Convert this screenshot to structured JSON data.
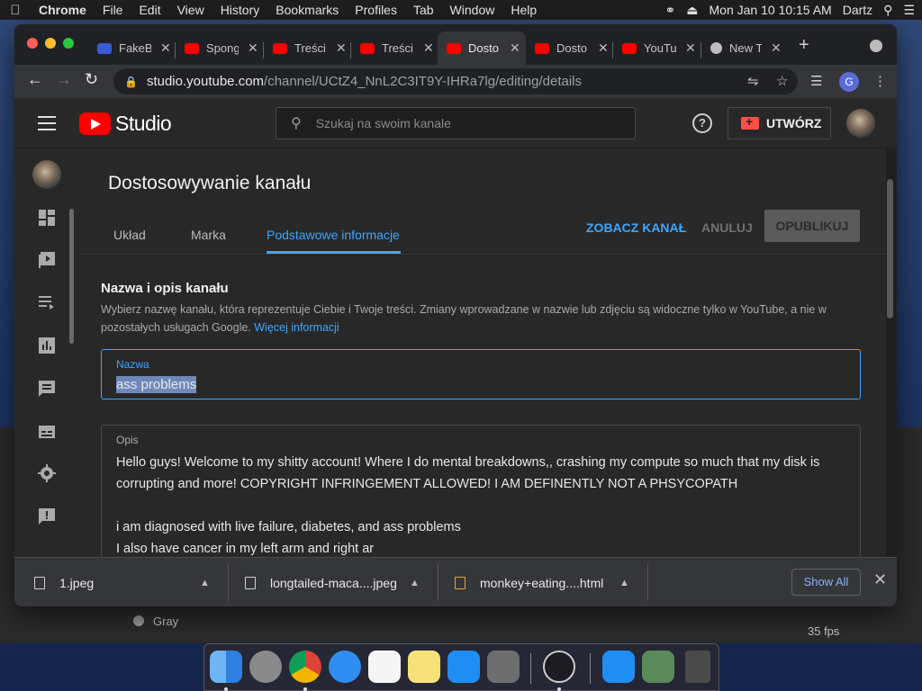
{
  "menubar": {
    "apple": "",
    "items": [
      "Chrome",
      "File",
      "Edit",
      "View",
      "History",
      "Bookmarks",
      "Profiles",
      "Tab",
      "Window",
      "Help"
    ],
    "datetime": "Mon Jan 10  10:15 AM",
    "user": "Dartz"
  },
  "tabs": [
    {
      "title": "FakeB",
      "color": "#3a5bd9"
    },
    {
      "title": "Spong",
      "color": "#ff0000"
    },
    {
      "title": "Treści",
      "color": "#ff0000"
    },
    {
      "title": "Treści",
      "color": "#ff0000"
    },
    {
      "title": "Dosto",
      "color": "#ff0000"
    },
    {
      "title": "Dosto",
      "color": "#ff0000"
    },
    {
      "title": "YouTu",
      "color": "#ff0000"
    },
    {
      "title": "New T",
      "color": "#bdbdbd"
    }
  ],
  "address": {
    "host": "studio.youtube.com",
    "path": "/channel/UCtZ4_NnL2C3IT9Y-IHRa7lg/editing/details"
  },
  "profile_initial": "G",
  "studio": {
    "logo_text": "Studio",
    "search_placeholder": "Szukaj na swoim kanale",
    "help_symbol": "?",
    "create_label": "UTWÓRZ"
  },
  "page": {
    "title": "Dostosowywanie kanału",
    "tabs": [
      "Układ",
      "Marka",
      "Podstawowe informacje"
    ],
    "active_tab": "Podstawowe informacje",
    "view_channel": "ZOBACZ KANAŁ",
    "cancel": "ANULUJ",
    "publish": "OPUBLIKUJ"
  },
  "section": {
    "title": "Nazwa i opis kanału",
    "desc": "Wybierz nazwę kanału, która reprezentuje Ciebie i Twoje treści. Zmiany wprowadzane w nazwie lub zdjęciu są widoczne tylko w YouTube, a nie w pozostałych usługach Google. ",
    "more_link": "Więcej informacji"
  },
  "name_field": {
    "label": "Nazwa",
    "value": "ass problems"
  },
  "desc_field": {
    "label": "Opis",
    "lines": [
      "Hello guys! Welcome to my shitty account! Where I do mental breakdowns,, crashing my compute so much that my disk is corrupting and more! COPYRIGHT INFRINGEMENT ALLOWED! I AM DEFINENTLY NOT A  PHSYCOPATH",
      "",
      "i am diagnosed with live failure, diabetes, and ass problems",
      "I also have cancer in my left arm and right ar"
    ]
  },
  "downloads": {
    "items": [
      "1.jpeg",
      "longtailed-maca....jpeg",
      "monkey+eating....html"
    ],
    "show_all": "Show All"
  },
  "background": {
    "obs_gray": "Gray",
    "fps": "35 fps"
  }
}
